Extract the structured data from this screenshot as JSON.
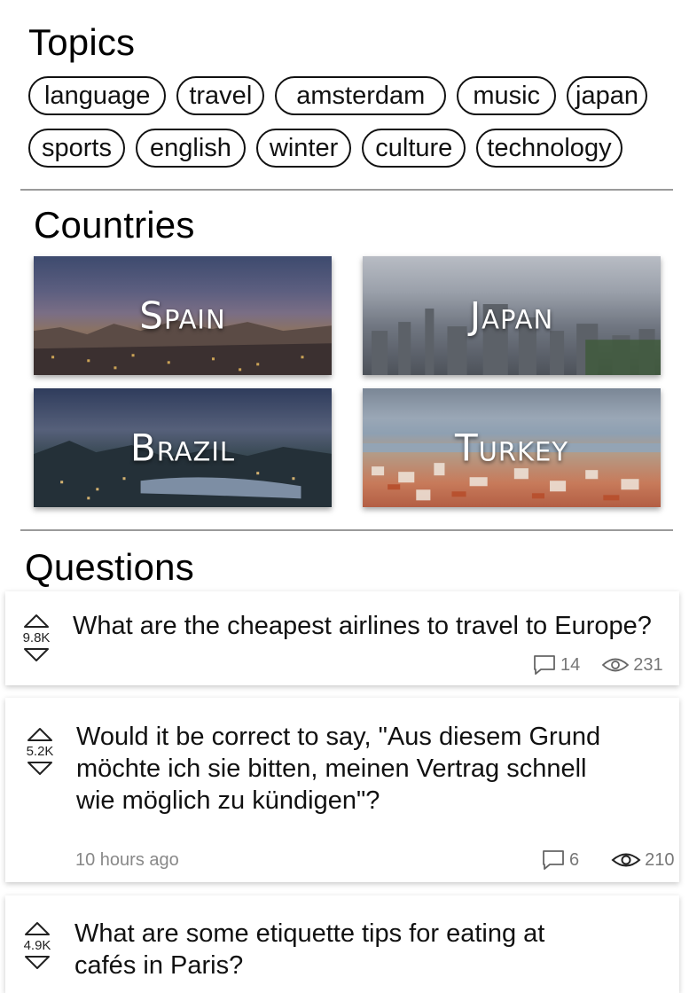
{
  "topics": {
    "title": "Topics",
    "row1": [
      "language",
      "travel",
      "amsterdam",
      "music",
      "japan"
    ],
    "row2": [
      "sports",
      "english",
      "winter",
      "culture",
      "technology"
    ]
  },
  "countries": {
    "title": "Countries",
    "items": [
      {
        "name": "Spain"
      },
      {
        "name": "Japan"
      },
      {
        "name": "Brazil"
      },
      {
        "name": "Turkey"
      }
    ]
  },
  "questions": {
    "title": "Questions",
    "items": [
      {
        "votes": "9.8K",
        "text": "What are the cheapest airlines to travel to Europe?",
        "time": "",
        "comments": "14",
        "views": "231"
      },
      {
        "votes": "5.2K",
        "text": "Would it be correct to say, \"Aus diesem Grund möchte ich sie bitten, meinen Vertrag schnell wie möglich zu kündigen\"?",
        "time": "10 hours ago",
        "comments": "6",
        "views": "210"
      },
      {
        "votes": "4.9K",
        "text": "What are some etiquette tips for eating at cafés in Paris?",
        "time": "",
        "comments": "",
        "views": ""
      }
    ]
  }
}
